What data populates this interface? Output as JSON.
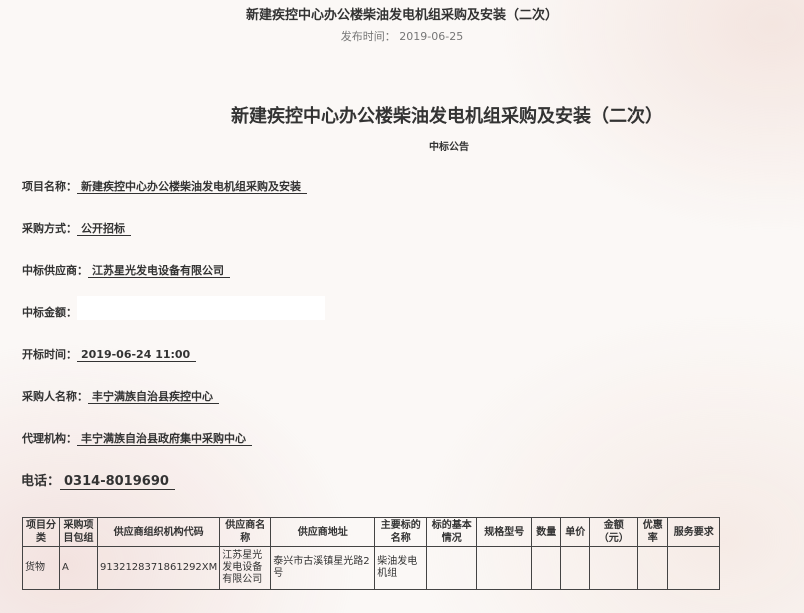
{
  "header": {
    "title": "新建疾控中心办公楼柴油发电机组采购及安装（二次）",
    "pub_date": "发布时间： 2019-06-25"
  },
  "notice": {
    "title": "新建疾控中心办公楼柴油发电机组采购及安装（二次）",
    "subtitle": "中标公告",
    "fields": [
      {
        "label": "项目名称：",
        "value": "新建疾控中心办公楼柴油发电机组采购及安装"
      },
      {
        "label": "采购方式：",
        "value": "公开招标"
      },
      {
        "label": "中标供应商：",
        "value": "江苏星光发电设备有限公司"
      },
      {
        "label": "中标金额：",
        "value": ""
      },
      {
        "label": "开标时间：",
        "value": "2019-06-24 11:00"
      },
      {
        "label": "采购人名称：",
        "value": "丰宁满族自治县疾控中心"
      },
      {
        "label": "代理机构：",
        "value": "丰宁满族自治县政府集中采购中心"
      },
      {
        "label": "电话：",
        "value": "0314-8019690"
      }
    ]
  },
  "table": {
    "headers": [
      "项目分类",
      "采购项目包组",
      "供应商组织机构代码",
      "供应商名称",
      "供应商地址",
      "主要标的名称",
      "标的基本情况",
      "规格型号",
      "数量",
      "单价",
      "金额（元）",
      "优惠率",
      "服务要求"
    ],
    "rows": [
      [
        "货物",
        "A",
        "9132128371861292XM",
        "江苏星光发电设备有限公司",
        "泰兴市古溪镇星光路2号",
        "柴油发电机组",
        "",
        "",
        "",
        "",
        "",
        "",
        ""
      ]
    ]
  }
}
